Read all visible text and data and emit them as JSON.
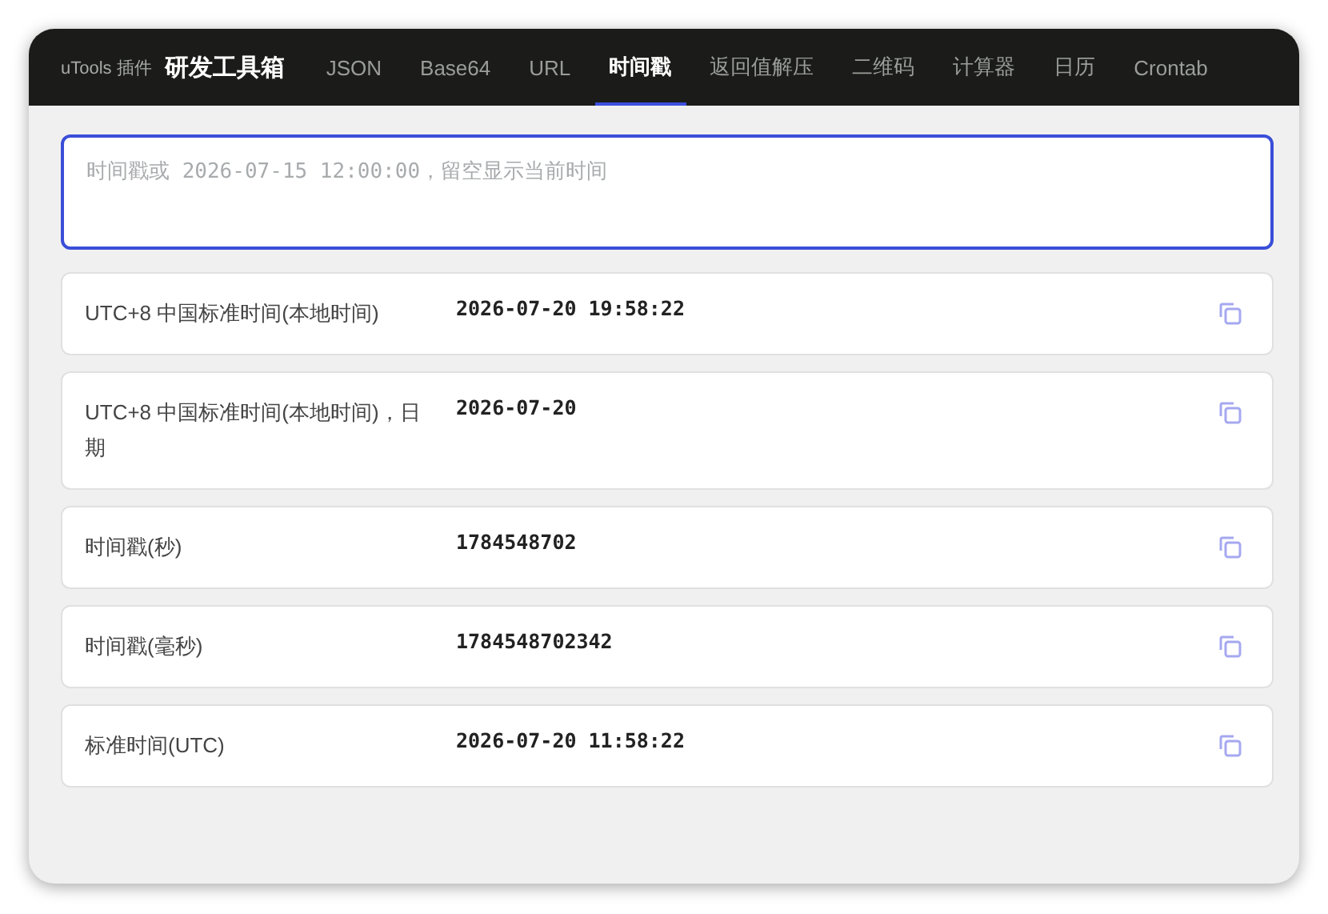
{
  "header": {
    "brand_small": "uTools 插件",
    "brand": "研发工具箱"
  },
  "tabs": [
    {
      "label": "JSON",
      "selected": false
    },
    {
      "label": "Base64",
      "selected": false
    },
    {
      "label": "URL",
      "selected": false
    },
    {
      "label": "时间戳",
      "selected": true
    },
    {
      "label": "返回值解压",
      "selected": false
    },
    {
      "label": "二维码",
      "selected": false
    },
    {
      "label": "计算器",
      "selected": false
    },
    {
      "label": "日历",
      "selected": false
    },
    {
      "label": "Crontab",
      "selected": false
    }
  ],
  "input": {
    "placeholder": "时间戳或 2026-07-15 12:00:00，留空显示当前时间"
  },
  "results": [
    {
      "label": "UTC+8 中国标准时间(本地时间)",
      "value": "2026-07-20 19:58:22"
    },
    {
      "label": "UTC+8 中国标准时间(本地时间)，日期",
      "value": "2026-07-20"
    },
    {
      "label": "时间戳(秒)",
      "value": "1784548702"
    },
    {
      "label": "时间戳(毫秒)",
      "value": "1784548702342"
    },
    {
      "label": "标准时间(UTC)",
      "value": "2026-07-20 11:58:22"
    }
  ]
}
